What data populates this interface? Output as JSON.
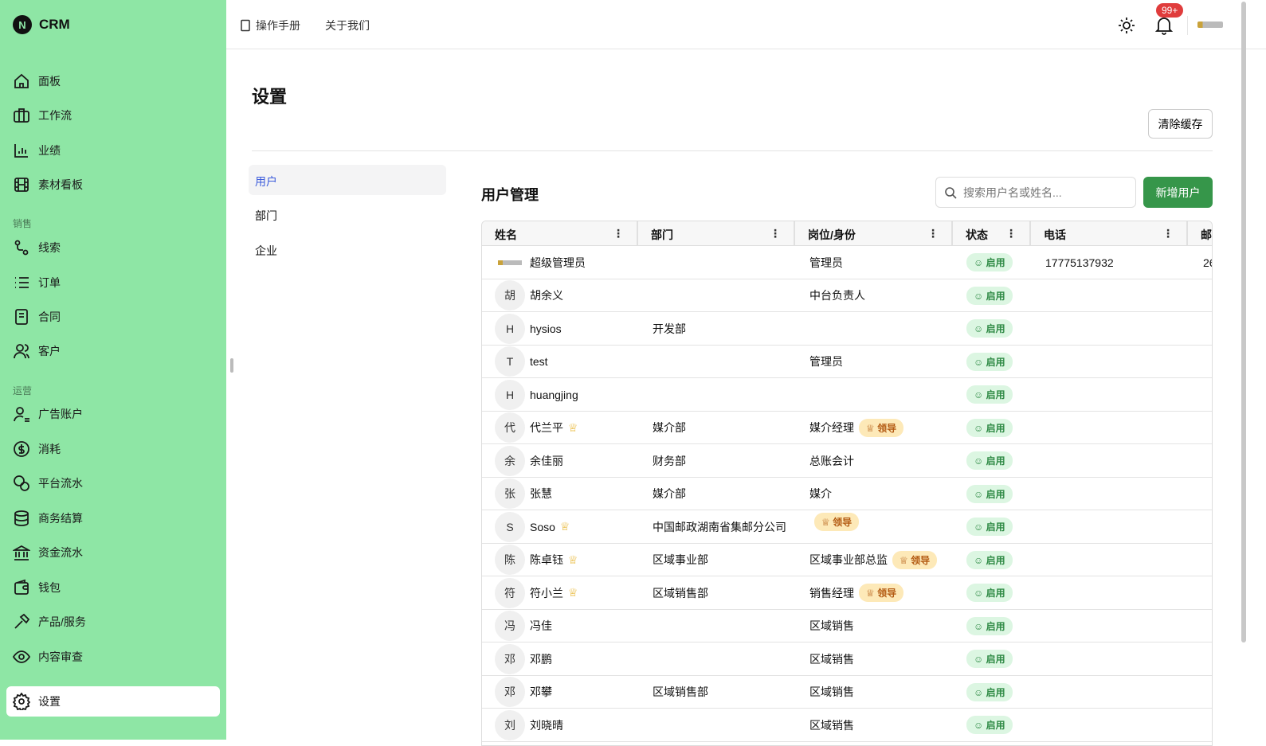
{
  "brand": {
    "logo_letter": "N",
    "name": "CRM"
  },
  "sidebar": {
    "items": [
      {
        "label": "面板",
        "icon": "home-icon"
      },
      {
        "label": "工作流",
        "icon": "briefcase-icon"
      },
      {
        "label": "业绩",
        "icon": "bar-chart-icon"
      },
      {
        "label": "素材看板",
        "icon": "film-icon"
      }
    ],
    "section_sales": "销售",
    "sales_items": [
      {
        "label": "线索",
        "icon": "route-icon"
      },
      {
        "label": "订单",
        "icon": "list-icon"
      },
      {
        "label": "合同",
        "icon": "document-icon"
      },
      {
        "label": "客户",
        "icon": "users-icon"
      }
    ],
    "section_ops": "运营",
    "ops_items": [
      {
        "label": "广告账户",
        "icon": "user-icon"
      },
      {
        "label": "消耗",
        "icon": "dollar-icon"
      },
      {
        "label": "平台流水",
        "icon": "coins-icon"
      },
      {
        "label": "商务结算",
        "icon": "database-icon"
      },
      {
        "label": "资金流水",
        "icon": "bank-icon"
      },
      {
        "label": "钱包",
        "icon": "wallet-icon"
      },
      {
        "label": "产品/服务",
        "icon": "hammer-icon"
      },
      {
        "label": "内容审查",
        "icon": "eye-icon"
      }
    ],
    "settings": "设置"
  },
  "header": {
    "manual": "操作手册",
    "about": "关于我们",
    "notifications": "99+"
  },
  "page": {
    "title": "设置",
    "clear_cache": "清除缓存"
  },
  "subnav": [
    "用户",
    "部门",
    "企业"
  ],
  "users": {
    "title": "用户管理",
    "search_placeholder": "搜索用户名或姓名...",
    "add": "新增用户",
    "columns": [
      "姓名",
      "部门",
      "岗位/身份",
      "状态",
      "电话",
      "邮"
    ],
    "rows": [
      {
        "avatar": "",
        "name": "超级管理员",
        "dept": "",
        "role": "管理员",
        "leader": false,
        "crown": false,
        "status": "启用",
        "phone": "17775137932",
        "email": "26"
      },
      {
        "avatar": "胡",
        "name": "胡余义",
        "dept": "",
        "role": "中台负责人",
        "leader": false,
        "crown": false,
        "status": "启用",
        "phone": "",
        "email": ""
      },
      {
        "avatar": "H",
        "name": "hysios",
        "dept": "开发部",
        "role": "",
        "leader": false,
        "crown": false,
        "status": "启用",
        "phone": "",
        "email": ""
      },
      {
        "avatar": "T",
        "name": "test",
        "dept": "",
        "role": "管理员",
        "leader": false,
        "crown": false,
        "status": "启用",
        "phone": "",
        "email": ""
      },
      {
        "avatar": "H",
        "name": "huangjing",
        "dept": "",
        "role": "",
        "leader": false,
        "crown": false,
        "status": "启用",
        "phone": "",
        "email": ""
      },
      {
        "avatar": "代",
        "name": "代兰平",
        "dept": "媒介部",
        "role": "媒介经理",
        "leader": true,
        "crown": true,
        "status": "启用",
        "phone": "",
        "email": ""
      },
      {
        "avatar": "余",
        "name": "余佳丽",
        "dept": "财务部",
        "role": "总账会计",
        "leader": false,
        "crown": false,
        "status": "启用",
        "phone": "",
        "email": ""
      },
      {
        "avatar": "张",
        "name": "张慧",
        "dept": "媒介部",
        "role": "媒介",
        "leader": false,
        "crown": false,
        "status": "启用",
        "phone": "",
        "email": ""
      },
      {
        "avatar": "S",
        "name": "Soso",
        "dept": "中国邮政湖南省集邮分公司",
        "role": "",
        "leader": true,
        "crown": true,
        "status": "启用",
        "phone": "",
        "email": ""
      },
      {
        "avatar": "陈",
        "name": "陈卓钰",
        "dept": "区域事业部",
        "role": "区域事业部总监",
        "leader": true,
        "crown": true,
        "status": "启用",
        "phone": "",
        "email": ""
      },
      {
        "avatar": "符",
        "name": "符小兰",
        "dept": "区域销售部",
        "role": "销售经理",
        "leader": true,
        "crown": true,
        "status": "启用",
        "phone": "",
        "email": ""
      },
      {
        "avatar": "冯",
        "name": "冯佳",
        "dept": "",
        "role": "区域销售",
        "leader": false,
        "crown": false,
        "status": "启用",
        "phone": "",
        "email": ""
      },
      {
        "avatar": "邓",
        "name": "邓鹏",
        "dept": "",
        "role": "区域销售",
        "leader": false,
        "crown": false,
        "status": "启用",
        "phone": "",
        "email": ""
      },
      {
        "avatar": "邓",
        "name": "邓攀",
        "dept": "区域销售部",
        "role": "区域销售",
        "leader": false,
        "crown": false,
        "status": "启用",
        "phone": "",
        "email": ""
      },
      {
        "avatar": "刘",
        "name": "刘晓晴",
        "dept": "",
        "role": "区域销售",
        "leader": false,
        "crown": false,
        "status": "启用",
        "phone": "",
        "email": ""
      }
    ],
    "leader_label": "领导"
  }
}
